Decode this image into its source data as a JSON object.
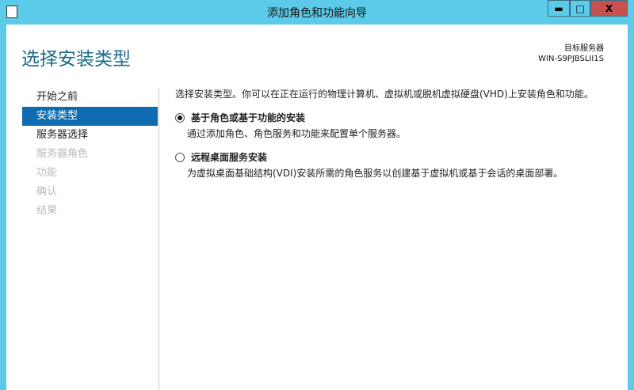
{
  "window": {
    "title": "添加角色和功能向导",
    "min": "▬",
    "max": "□",
    "close": "X"
  },
  "header": {
    "title": "选择安装类型",
    "target_label": "目标服务器",
    "target_server": "WIN-S9PJBSLII1S"
  },
  "nav": [
    {
      "label": "开始之前",
      "state": "normal"
    },
    {
      "label": "安装类型",
      "state": "active"
    },
    {
      "label": "服务器选择",
      "state": "normal"
    },
    {
      "label": "服务器角色",
      "state": "disabled"
    },
    {
      "label": "功能",
      "state": "disabled"
    },
    {
      "label": "确认",
      "state": "disabled"
    },
    {
      "label": "结果",
      "state": "disabled"
    }
  ],
  "main": {
    "intro": "选择安装类型。你可以在正在运行的物理计算机、虚拟机或脱机虚拟硬盘(VHD)上安装角色和功能。",
    "options": [
      {
        "label": "基于角色或基于功能的安装",
        "desc": "通过添加角色、角色服务和功能来配置单个服务器。",
        "selected": true
      },
      {
        "label": "远程桌面服务安装",
        "desc": "为虚拟桌面基础结构(VDI)安装所需的角色服务以创建基于虚拟机或基于会话的桌面部署。",
        "selected": false
      }
    ]
  }
}
